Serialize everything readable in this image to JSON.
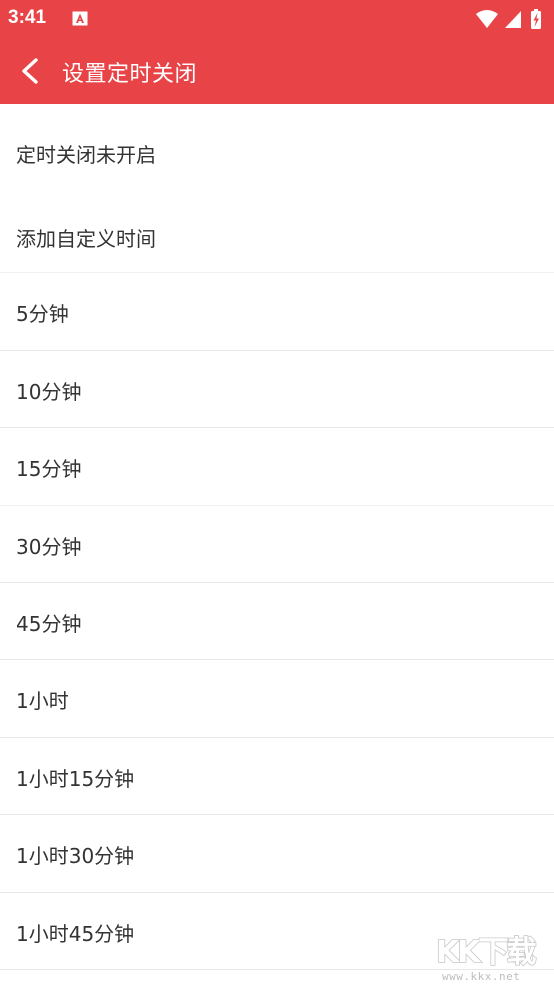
{
  "status_bar": {
    "time": "3:41",
    "icons": [
      "notification-a-icon",
      "wifi-icon",
      "cell-signal-icon",
      "battery-charging-icon"
    ]
  },
  "app_bar": {
    "title": "设置定时关闭",
    "back_icon": "back-arrow-icon"
  },
  "timer_status": {
    "label": "定时关闭未开启"
  },
  "options": [
    {
      "label": "添加自定义时间"
    },
    {
      "label": "5分钟"
    },
    {
      "label": "10分钟"
    },
    {
      "label": "15分钟"
    },
    {
      "label": "30分钟"
    },
    {
      "label": "45分钟"
    },
    {
      "label": "1小时"
    },
    {
      "label": "1小时15分钟"
    },
    {
      "label": "1小时30分钟"
    },
    {
      "label": "1小时45分钟"
    }
  ],
  "watermark": {
    "logo_text": "KK下载",
    "url": "www.kkx.net"
  },
  "colors": {
    "accent": "#E84448",
    "text": "#333333",
    "divider": "#e6e6e6",
    "background": "#ffffff"
  }
}
